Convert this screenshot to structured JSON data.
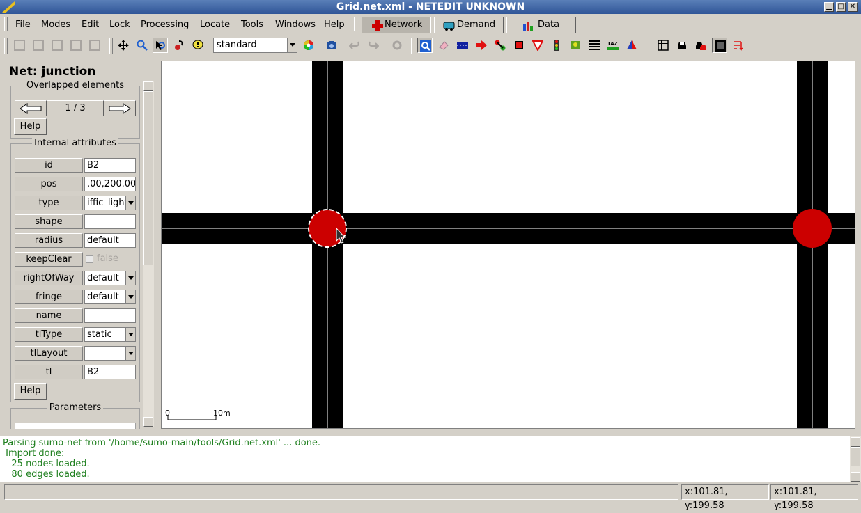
{
  "window": {
    "title": "Grid.net.xml - NETEDIT UNKNOWN",
    "minimize": "▁",
    "maximize": "□",
    "close": "✕"
  },
  "menu": {
    "items": [
      "File",
      "Modes",
      "Edit",
      "Lock",
      "Processing",
      "Locate",
      "Tools",
      "Windows",
      "Help"
    ]
  },
  "supermodes": [
    {
      "label": "Network",
      "icon": "network-icon",
      "active": true
    },
    {
      "label": "Demand",
      "icon": "demand-icon",
      "active": false
    },
    {
      "label": "Data",
      "icon": "data-icon",
      "active": false
    }
  ],
  "toolbar": {
    "viewport_scheme": "standard"
  },
  "panel": {
    "title": "Net: junction",
    "overlapped": {
      "title": "Overlapped elements",
      "counter": "1 / 3",
      "help": "Help"
    },
    "internal": {
      "title": "Internal attributes",
      "attributes": [
        {
          "label": "id",
          "value": "B2",
          "kind": "text"
        },
        {
          "label": "pos",
          "value": ".00,200.00",
          "kind": "text"
        },
        {
          "label": "type",
          "value": "iffic_light",
          "kind": "combo"
        },
        {
          "label": "shape",
          "value": "",
          "kind": "text"
        },
        {
          "label": "radius",
          "value": "default",
          "kind": "text"
        },
        {
          "label": "keepClear",
          "value": "false",
          "kind": "checkbox"
        },
        {
          "label": "rightOfWay",
          "value": "default",
          "kind": "combo"
        },
        {
          "label": "fringe",
          "value": "default",
          "kind": "combo"
        },
        {
          "label": "name",
          "value": "",
          "kind": "text"
        },
        {
          "label": "tlType",
          "value": "static",
          "kind": "combo"
        },
        {
          "label": "tlLayout",
          "value": "",
          "kind": "combo"
        },
        {
          "label": "tl",
          "value": "B2",
          "kind": "text"
        }
      ],
      "help": "Help"
    },
    "parameters": {
      "title": "Parameters"
    }
  },
  "canvas": {
    "scale_start": "0",
    "scale_end": "10m",
    "road_color": "#000000",
    "junction_color": "#cc0000",
    "background": "#ffffff"
  },
  "messages": [
    "Parsing sumo-net from '/home/sumo-main/tools/Grid.net.xml' ... done.",
    " Import done:",
    "   25 nodes loaded.",
    "   80 edges loaded."
  ],
  "status": {
    "coords_net": "x:101.81, y:199.58",
    "coords_geo": "x:101.81, y:199.58"
  }
}
